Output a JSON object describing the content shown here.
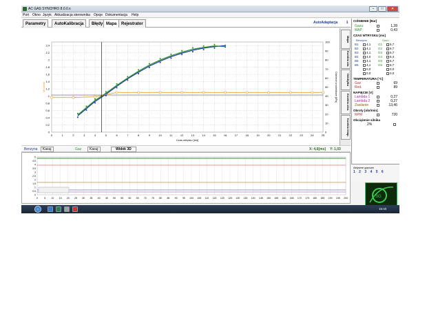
{
  "window": {
    "title": "AC GAS SYNCHRO  8.0.0.x"
  },
  "menu": [
    "Port",
    "Okno",
    "Język",
    "Aktualizacja sterownika",
    "Opcje",
    "Dokumentacja",
    "Help"
  ],
  "tabs": [
    "Parametry",
    "AutoKalibracja",
    "Błędy",
    "Mapa",
    "Rejestrator"
  ],
  "autoadaptation": "AutoAdaptacja",
  "side_tabs": [
    "Mapa",
    "Korekta obr.",
    "Odchyłka",
    "Korekta ciśn.",
    "Korekta temp."
  ],
  "chart_data": {
    "type": "scatter",
    "xlabel": "Czas wtrysku [ms]",
    "ylabel_left": "Mnożnik",
    "ylabel_right": "Ciśnienie w kolektorze [kPa]",
    "x_ticks": [
      "0",
      "1",
      "2",
      "3",
      "4",
      "5",
      "6",
      "7",
      "8",
      "9",
      "10",
      "11",
      "12",
      "13",
      "14",
      "15",
      "16",
      "17",
      "18",
      "19",
      "20",
      "21",
      "22",
      "23",
      "24",
      "25"
    ],
    "y_ticks_left": [
      "0",
      "0,2",
      "0,4",
      "0,6",
      "0,8",
      "1",
      "1,2",
      "1,4",
      "1,6",
      "1,8",
      "2",
      "2,2",
      "2,4"
    ],
    "y_ticks_right": [
      "0",
      "10",
      "20",
      "30",
      "40",
      "50",
      "60",
      "70",
      "80",
      "90",
      "100"
    ],
    "xlim": [
      0,
      25
    ],
    "ylim_left": [
      0,
      2.5
    ],
    "ylim_right": [
      0,
      100
    ],
    "series": [
      {
        "name": "Benzyna",
        "color": "#1a3aa0",
        "x": [
          2.4,
          3.2,
          4.0,
          5.0,
          6.0,
          7.0,
          8.0,
          9.0,
          10.0,
          11.0,
          12.0,
          13.0,
          14.0,
          15.0,
          16.0
        ],
        "y": [
          0.45,
          0.65,
          0.85,
          1.05,
          1.27,
          1.48,
          1.66,
          1.83,
          1.97,
          2.09,
          2.19,
          2.27,
          2.33,
          2.37,
          2.4
        ]
      },
      {
        "name": "Gaz",
        "color": "#2a8f2a",
        "x": [
          2.4,
          3.2,
          4.0,
          5.0,
          6.0,
          7.0,
          8.0,
          9.0,
          10.0,
          11.0,
          12.0,
          13.0,
          14.0,
          15.0,
          16.0
        ],
        "y": [
          0.48,
          0.68,
          0.88,
          1.08,
          1.3,
          1.5,
          1.69,
          1.86,
          2.0,
          2.12,
          2.22,
          2.3,
          2.35,
          2.39,
          2.37
        ]
      },
      {
        "name": "Mnożnik",
        "color": "#e8a020",
        "x": [
          0,
          2,
          4,
          6,
          8,
          10,
          12,
          14,
          16,
          18,
          20,
          22,
          24,
          25
        ],
        "y": [
          0.96,
          0.96,
          0.98,
          1.1,
          1.1,
          1.1,
          1.1,
          1.1,
          1.1,
          1.1,
          1.1,
          1.1,
          1.1,
          1.1
        ]
      }
    ],
    "cursor": {
      "x": 4.6,
      "y": 1.03
    }
  },
  "controls": {
    "benzyna": "Benzyna",
    "kasuj1": "Kasuj",
    "gaz": "Gaz",
    "kasuj2": "Kasuj",
    "widok3d": "Widok 3D",
    "xval": "X: 4,6[ms]",
    "yval": "Y: 1,03"
  },
  "bottom_chart": {
    "y_ticks": [
      "0",
      "0,5",
      "1",
      "1,5",
      "2",
      "2,5",
      "3",
      "3,5",
      "4",
      "4,5",
      "5"
    ],
    "x_ticks": [
      "0",
      "5",
      "10",
      "15",
      "20",
      "25",
      "30",
      "35",
      "40",
      "45",
      "50",
      "55",
      "60",
      "65",
      "70",
      "75",
      "80",
      "85",
      "90",
      "95",
      "100",
      "105",
      "110",
      "115",
      "120",
      "125",
      "130",
      "135",
      "140",
      "145",
      "150",
      "155",
      "160",
      "165",
      "170",
      "175",
      "180",
      "185",
      "190",
      "195",
      "200"
    ]
  },
  "panel": {
    "pressure_title": "CIŚNIENIE [Bar]",
    "gaz_label": "Gazu",
    "gaz_val": "1,28",
    "map_label": "MAP",
    "map_val": "0,43",
    "inj_title": "CZAS WTRYSKU [ms]",
    "benzyna_h": "Benzyna",
    "gaz_h": "Gazu",
    "injectors": [
      [
        "B1",
        "4,1",
        "G1",
        "5,7"
      ],
      [
        "B2",
        "4,1",
        "G2",
        "5,7"
      ],
      [
        "B3",
        "4,1",
        "G3",
        "5,7"
      ],
      [
        "B4",
        "4,0",
        "G4",
        "5,4"
      ],
      [
        "B5",
        "4,1",
        "G5",
        "5,7"
      ],
      [
        "B6",
        "4,1",
        "G6",
        "5,7"
      ],
      [
        "",
        "0,0",
        "",
        "0,0"
      ],
      [
        "",
        "0,0",
        "",
        "0,0"
      ]
    ],
    "temp_title": "TEMPERATURA [°C]",
    "temp_gaz_label": "Gaz",
    "temp_gaz_val": "69",
    "temp_red_label": "Red.",
    "temp_red_val": "89",
    "volt_title": "NAPIĘCIE [V]",
    "lambda1_label": "Lambda 1",
    "lambda1_val": "0,27",
    "lambda2_label": "Lambda 2",
    "lambda2_val": "0,27",
    "zasil_label": "Zasilanie",
    "zasil_val": "13,46",
    "rpm_title": "Obroty [obr/min]",
    "rpm_label": "RPM",
    "rpm_val": "720",
    "load_title": "Obciążenie silnika",
    "load_val": "2%",
    "active_injectors_title": "Aktywne gazowe",
    "active_injectors": [
      "1",
      "2",
      "3",
      "4",
      "5",
      "6"
    ],
    "fuel_label": "Gaz"
  },
  "status": {
    "connection": "Połączony",
    "device": "STAG-300-6 ISA2",
    "version": "wer. 8.9  4.0.0",
    "datetime": "2012-05-31  15:36:50"
  },
  "taskbar": {
    "clock": "15:40"
  }
}
